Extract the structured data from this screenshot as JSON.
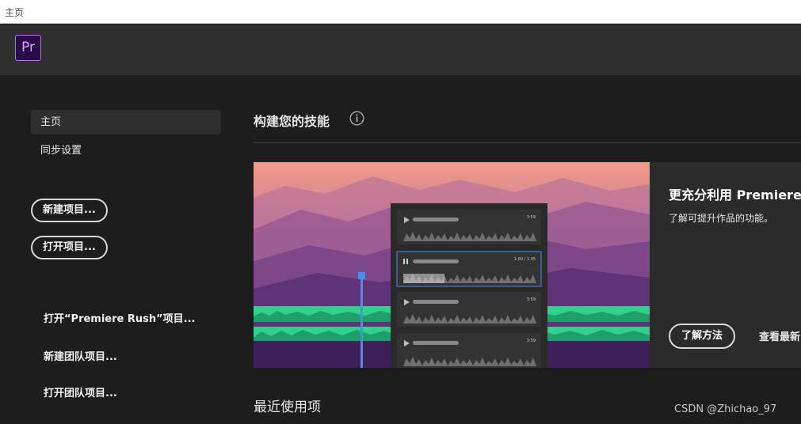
{
  "window": {
    "title": "主页"
  },
  "header": {
    "logo_text": "Pr",
    "logo_color": "#b76ff2"
  },
  "sidebar": {
    "nav": [
      {
        "label": "主页",
        "active": true
      },
      {
        "label": "同步设置",
        "active": false
      }
    ],
    "buttons": {
      "new_project": "新建项目...",
      "open_project": "打开项目..."
    },
    "links": {
      "open_rush": "打开“Premiere Rush”项目...",
      "new_team": "新建团队项目...",
      "open_team": "打开团队项目..."
    }
  },
  "main": {
    "skills_title": "构建您的技能",
    "info_icon": "info-icon",
    "card": {
      "title": "更充分利用 Premiere",
      "description": "了解可提升作品的功能。",
      "learn_button": "了解方法",
      "view_link": "查看最新",
      "tracks": [
        {
          "time": "3:59",
          "playing": false
        },
        {
          "time": "1:00 / 1:35",
          "playing": true
        },
        {
          "time": "3:59",
          "playing": false
        },
        {
          "time": "3:59",
          "playing": false
        }
      ],
      "accent": "#2fd18b"
    },
    "recent_title": "最近使用项"
  },
  "watermark": "CSDN @Zhichao_97"
}
